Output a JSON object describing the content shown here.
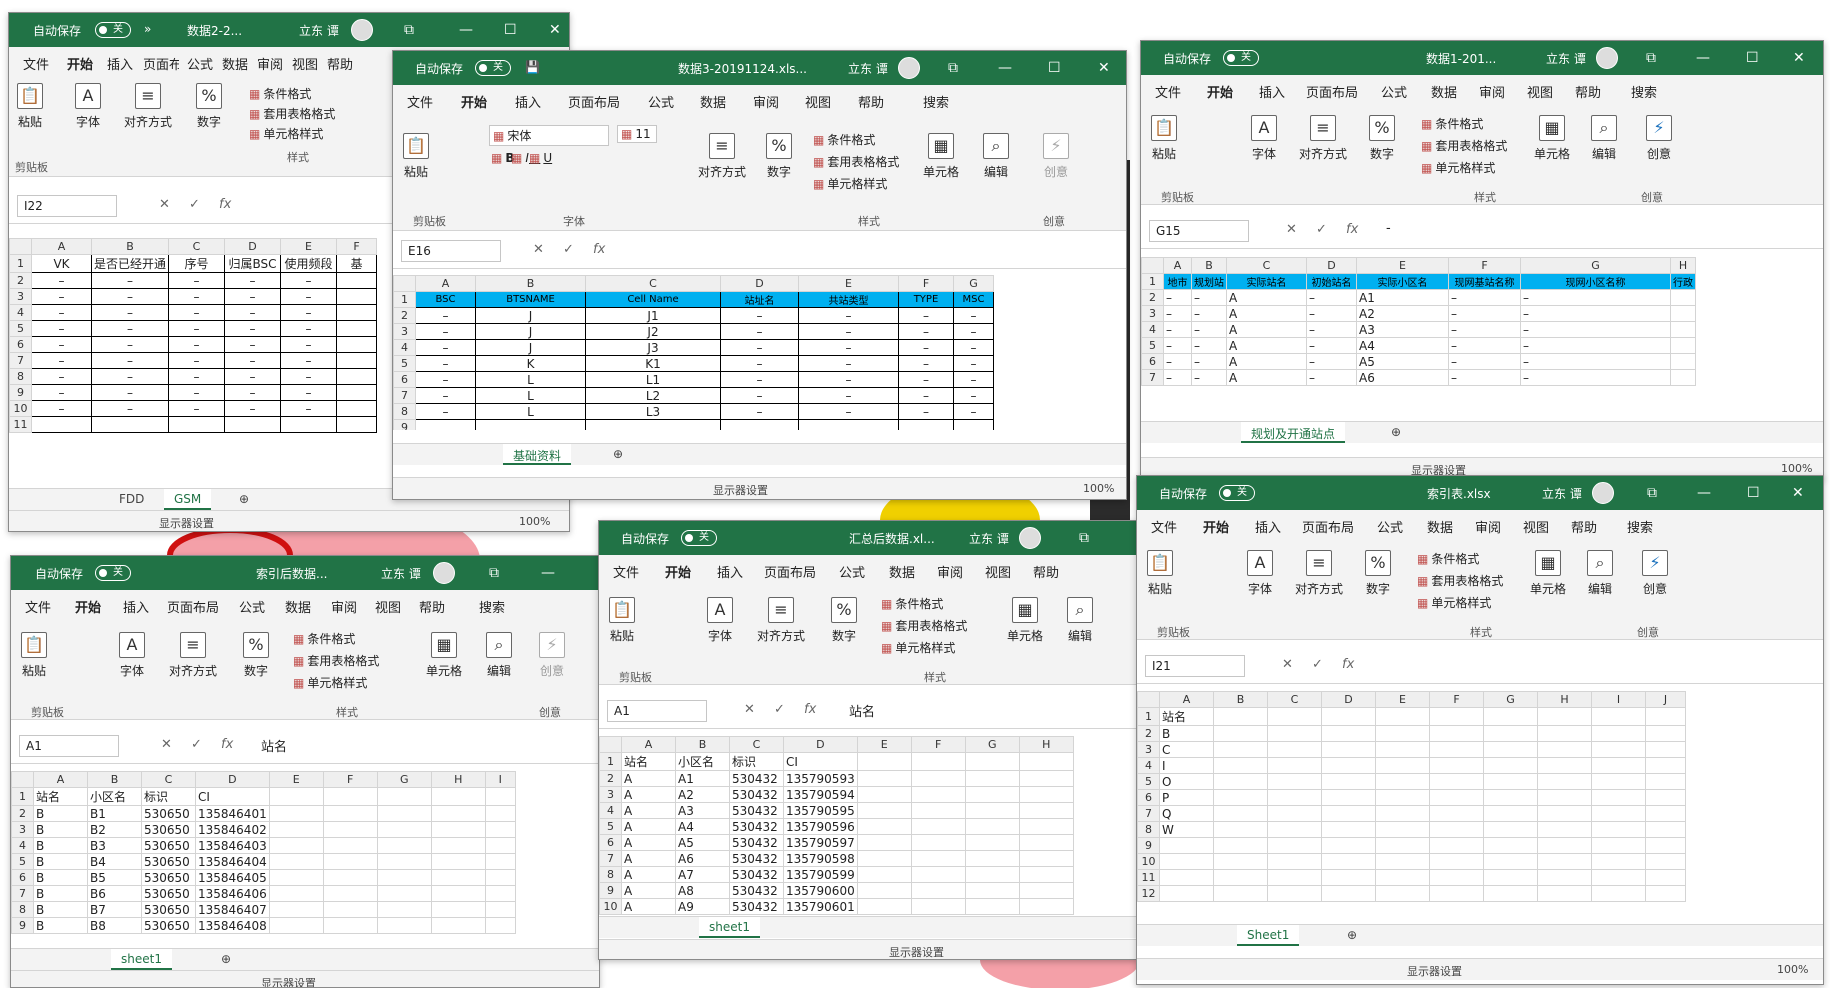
{
  "colors": {
    "excel_green": "#217346",
    "header_blue": "#00b0f0"
  },
  "common": {
    "autosave": "自动保存",
    "off": "关",
    "user": "立东 谭",
    "min": "—",
    "max": "☐",
    "close": "✕",
    "restore": "⧉",
    "menu": [
      "文件",
      "开始",
      "插入",
      "页面布局",
      "公式",
      "数据",
      "审阅",
      "视图",
      "帮助",
      "搜索"
    ],
    "paste": "粘贴",
    "font": "字体",
    "align": "对齐方式",
    "number": "数字",
    "cond": "条件格式",
    "tablefmt": "套用表格格式",
    "cellstyle": "单元格样式",
    "cells": "单元格",
    "edit": "编辑",
    "creative": "创意",
    "g_clip": "剪贴板",
    "g_font": "字体",
    "g_style": "样式",
    "g_create": "创意",
    "display": "显示器设置",
    "zoom": "100%",
    "fx": "fx",
    "cancel": "✕",
    "confirm": "✓"
  },
  "w1": {
    "title": "数据2-2...",
    "namebox": "I22",
    "cols": [
      "A",
      "B",
      "C",
      "D",
      "E",
      "F"
    ],
    "header": [
      "VK",
      "是否已经开通",
      "序号",
      "归属BSC",
      "使用频段",
      "基"
    ],
    "rows": [
      [
        "2",
        "–",
        "–",
        "–",
        "–",
        "–"
      ],
      [
        "3",
        "–",
        "–",
        "–",
        "–",
        "–"
      ],
      [
        "4",
        "–",
        "–",
        "–",
        "–",
        "–"
      ],
      [
        "5",
        "–",
        "–",
        "–",
        "–",
        "–"
      ],
      [
        "6",
        "–",
        "–",
        "–",
        "–",
        "–"
      ],
      [
        "7",
        "–",
        "–",
        "–",
        "–",
        "–"
      ],
      [
        "8",
        "–",
        "–",
        "–",
        "–",
        "–"
      ],
      [
        "9",
        "–",
        "–",
        "–",
        "–",
        "–"
      ],
      [
        "10",
        "–",
        "–",
        "–",
        "–",
        "–"
      ],
      [
        "11",
        "",
        "",
        "",
        "",
        ""
      ]
    ],
    "tabs": [
      "FDD",
      "GSM"
    ]
  },
  "w2": {
    "title": "数据3-20191124.xls...",
    "namebox": "E16",
    "fontname": "宋体",
    "fontsize": "11",
    "cols": [
      "A",
      "B",
      "C",
      "D",
      "E",
      "F",
      "G"
    ],
    "header": [
      "BSC",
      "BTSNAME",
      "Cell Name",
      "站址名",
      "共站类型",
      "TYPE",
      "MSC"
    ],
    "rows": [
      [
        "2",
        "–",
        "J",
        "J1",
        "–",
        "–",
        "–",
        "–"
      ],
      [
        "3",
        "–",
        "J",
        "J2",
        "–",
        "–",
        "–",
        "–"
      ],
      [
        "4",
        "–",
        "J",
        "J3",
        "–",
        "–",
        "–",
        "–"
      ],
      [
        "5",
        "–",
        "K",
        "K1",
        "–",
        "–",
        "–",
        "–"
      ],
      [
        "6",
        "–",
        "L",
        "L1",
        "–",
        "–",
        "–",
        "–"
      ],
      [
        "7",
        "–",
        "L",
        "L2",
        "–",
        "–",
        "–",
        "–"
      ],
      [
        "8",
        "–",
        "L",
        "L3",
        "–",
        "–",
        "–",
        "–"
      ],
      [
        "9",
        "",
        "",
        "",
        "",
        "",
        "",
        ""
      ]
    ],
    "tabs": [
      "基础资料"
    ]
  },
  "w3": {
    "title": "数据1-201...",
    "namebox": "G15",
    "fval": "-",
    "cols": [
      "A",
      "B",
      "C",
      "D",
      "E",
      "F",
      "G",
      "H"
    ],
    "header": [
      "地市",
      "规划站",
      "实际站名",
      "初始站名",
      "实际小区名",
      "现网基站名称",
      "现网小区名称",
      "行政"
    ],
    "rows": [
      [
        "2",
        "–",
        "–",
        "A",
        "–",
        "A1",
        "–",
        "–",
        ""
      ],
      [
        "3",
        "–",
        "–",
        "A",
        "–",
        "A2",
        "–",
        "–",
        ""
      ],
      [
        "4",
        "–",
        "–",
        "A",
        "–",
        "A3",
        "–",
        "–",
        ""
      ],
      [
        "5",
        "–",
        "–",
        "A",
        "–",
        "A4",
        "–",
        "–",
        ""
      ],
      [
        "6",
        "–",
        "–",
        "A",
        "–",
        "A5",
        "–",
        "–",
        ""
      ],
      [
        "7",
        "–",
        "–",
        "A",
        "–",
        "A6",
        "–",
        "–",
        ""
      ]
    ],
    "tabs": [
      "规划及开通站点"
    ]
  },
  "w4": {
    "title": "索引后数据...",
    "namebox": "A1",
    "fval": "站名",
    "cols": [
      "A",
      "B",
      "C",
      "D",
      "E",
      "F",
      "G",
      "H",
      "I"
    ],
    "rows": [
      [
        "1",
        "站名",
        "小区名",
        "标识",
        "CI"
      ],
      [
        "2",
        "B",
        "B1",
        "530650",
        "135846401"
      ],
      [
        "3",
        "B",
        "B2",
        "530650",
        "135846402"
      ],
      [
        "4",
        "B",
        "B3",
        "530650",
        "135846403"
      ],
      [
        "5",
        "B",
        "B4",
        "530650",
        "135846404"
      ],
      [
        "6",
        "B",
        "B5",
        "530650",
        "135846405"
      ],
      [
        "7",
        "B",
        "B6",
        "530650",
        "135846406"
      ],
      [
        "8",
        "B",
        "B7",
        "530650",
        "135846407"
      ],
      [
        "9",
        "B",
        "B8",
        "530650",
        "135846408"
      ]
    ],
    "tabs": [
      "sheet1"
    ]
  },
  "w5": {
    "title": "汇总后数据.xl...",
    "namebox": "A1",
    "fval": "站名",
    "cols": [
      "A",
      "B",
      "C",
      "D",
      "E",
      "F",
      "G",
      "H"
    ],
    "rows": [
      [
        "1",
        "站名",
        "小区名",
        "标识",
        "CI"
      ],
      [
        "2",
        "A",
        "A1",
        "530432",
        "135790593"
      ],
      [
        "3",
        "A",
        "A2",
        "530432",
        "135790594"
      ],
      [
        "4",
        "A",
        "A3",
        "530432",
        "135790595"
      ],
      [
        "5",
        "A",
        "A4",
        "530432",
        "135790596"
      ],
      [
        "6",
        "A",
        "A5",
        "530432",
        "135790597"
      ],
      [
        "7",
        "A",
        "A6",
        "530432",
        "135790598"
      ],
      [
        "8",
        "A",
        "A7",
        "530432",
        "135790599"
      ],
      [
        "9",
        "A",
        "A8",
        "530432",
        "135790600"
      ],
      [
        "10",
        "A",
        "A9",
        "530432",
        "135790601"
      ]
    ],
    "tabs": [
      "sheet1"
    ]
  },
  "w6": {
    "title": "索引表.xlsx",
    "namebox": "I21",
    "cols": [
      "A",
      "B",
      "C",
      "D",
      "E",
      "F",
      "G",
      "H",
      "I",
      "J"
    ],
    "rows": [
      [
        "1",
        "站名"
      ],
      [
        "2",
        "B"
      ],
      [
        "3",
        "C"
      ],
      [
        "4",
        "I"
      ],
      [
        "5",
        "O"
      ],
      [
        "6",
        "P"
      ],
      [
        "7",
        "Q"
      ],
      [
        "8",
        "W"
      ],
      [
        "9",
        ""
      ],
      [
        "10",
        ""
      ],
      [
        "11",
        ""
      ],
      [
        "12",
        ""
      ]
    ],
    "tabs": [
      "Sheet1"
    ]
  }
}
